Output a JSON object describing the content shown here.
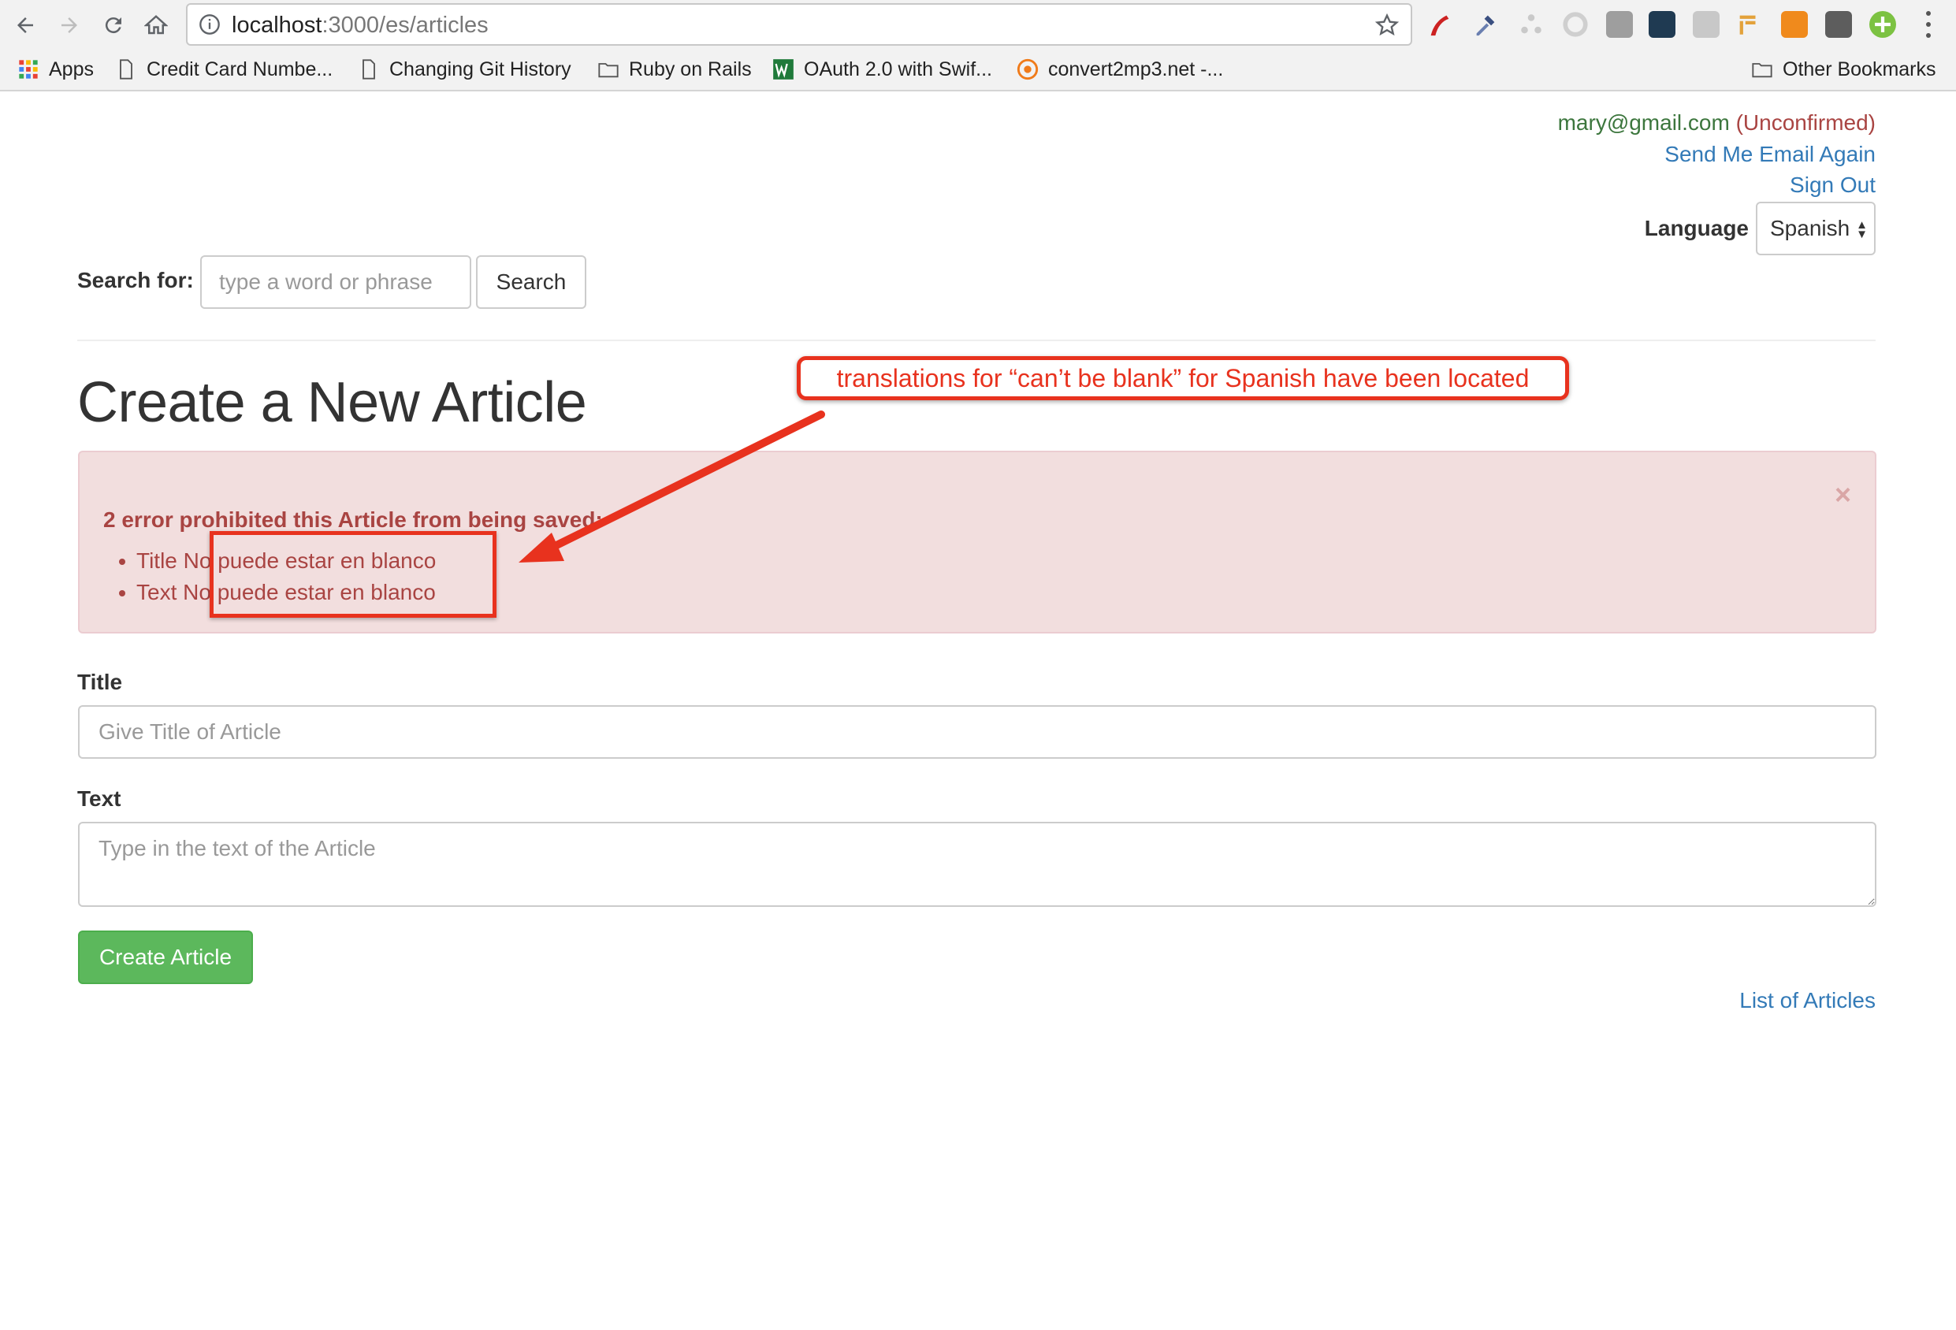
{
  "browser": {
    "url_host": "localhost",
    "url_rest": ":3000/es/articles",
    "bookmarks": [
      {
        "label": "Apps"
      },
      {
        "label": "Credit Card Numbe..."
      },
      {
        "label": "Changing Git History"
      },
      {
        "label": "Ruby on Rails"
      },
      {
        "label": "OAuth 2.0 with Swif..."
      },
      {
        "label": "convert2mp3.net -..."
      },
      {
        "label": "Other Bookmarks"
      }
    ]
  },
  "header": {
    "email": "mary@gmail.com",
    "unconfirmed": "(Unconfirmed)",
    "send_again": "Send Me Email Again",
    "sign_out": "Sign Out",
    "language_label": "Language",
    "language_value": "Spanish"
  },
  "search": {
    "label": "Search for:",
    "placeholder": "type a word or phrase",
    "button": "Search"
  },
  "page": {
    "title": "Create a New Article"
  },
  "errors": {
    "close": "×",
    "heading": "2 error prohibited this Article from being saved:",
    "items": [
      {
        "text": "Title No puede estar en blanco"
      },
      {
        "text": "Text No puede estar en blanco"
      }
    ]
  },
  "form": {
    "title_label": "Title",
    "title_placeholder": "Give Title of Article",
    "text_label": "Text",
    "text_placeholder": "Type in the text of the Article",
    "submit": "Create Article",
    "list_link": "List of Articles"
  },
  "annotation": {
    "callout": "translations for “can’t be blank” for Spanish have been located"
  },
  "colors": {
    "annotation_red": "#e8321e",
    "alert_bg": "#f2dede",
    "alert_text": "#a94442",
    "link_blue": "#337ab7",
    "success_green": "#5cb85c",
    "email_green": "#3c763d"
  }
}
